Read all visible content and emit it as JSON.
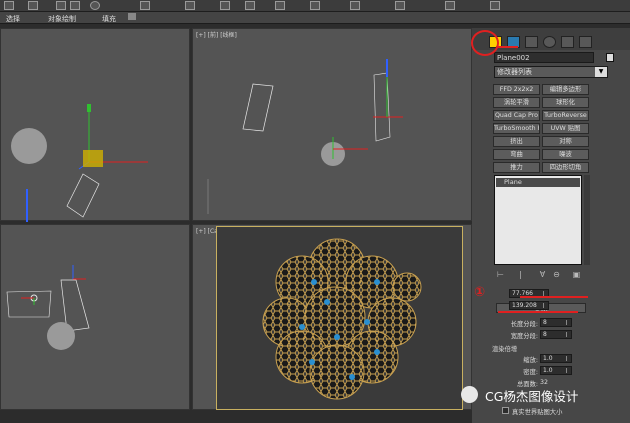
{
  "toolbar": {
    "icons": [
      "selection-icon",
      "rect-select-icon",
      "circle-select-icon",
      "move-icon",
      "rotate-icon",
      "scale-icon",
      "snap-icon",
      "mirror-icon",
      "align-icon",
      "layer-icon",
      "curve-icon",
      "schematic-icon",
      "material-icon",
      "render-icon",
      "render-frame-icon"
    ]
  },
  "ribbon": {
    "item1": "选择",
    "item2": "对象绘制",
    "item3": "填充"
  },
  "viewports": {
    "top_right_label": "[+] [前] [线框]",
    "bottom_right_label": "[+] [Camera001] [明暗处理]"
  },
  "panel": {
    "object_name": "Plane002",
    "modifier_list": "修改器列表",
    "buttons": [
      "FFD 2x2x2",
      "编辑多边形",
      "涡轮平滑",
      "球形化",
      "Quad Cap Pro",
      "TurboReverse",
      "TurboSmooth Pro",
      "UVW 贴图",
      "挤出",
      "对称",
      "弯曲",
      "噪波",
      "推力",
      "四边形切角"
    ],
    "stack_item": "Plane",
    "params_title": "参数",
    "length_label": "长度:",
    "length_value": "77.766",
    "width_label": "宽度:",
    "width_value": "139.208",
    "length_segs_label": "长度分段:",
    "length_segs_value": "8",
    "width_segs_label": "宽度分段:",
    "width_segs_value": "8",
    "render_mult_label": "渲染倍增",
    "scale_label": "缩放:",
    "scale_value": "1.0",
    "density_label": "密度:",
    "density_value": "1.0",
    "total_faces_label": "总面数:",
    "total_faces_value": "32",
    "real_world_label": "真实世界贴图大小"
  },
  "annotations": {
    "number": "①"
  },
  "watermark": {
    "text": "CG杨杰图像设计"
  },
  "colors": {
    "accent_red": "#e02020",
    "wire_gold": "#c8a050",
    "selected_yellow": "#ffd000"
  }
}
